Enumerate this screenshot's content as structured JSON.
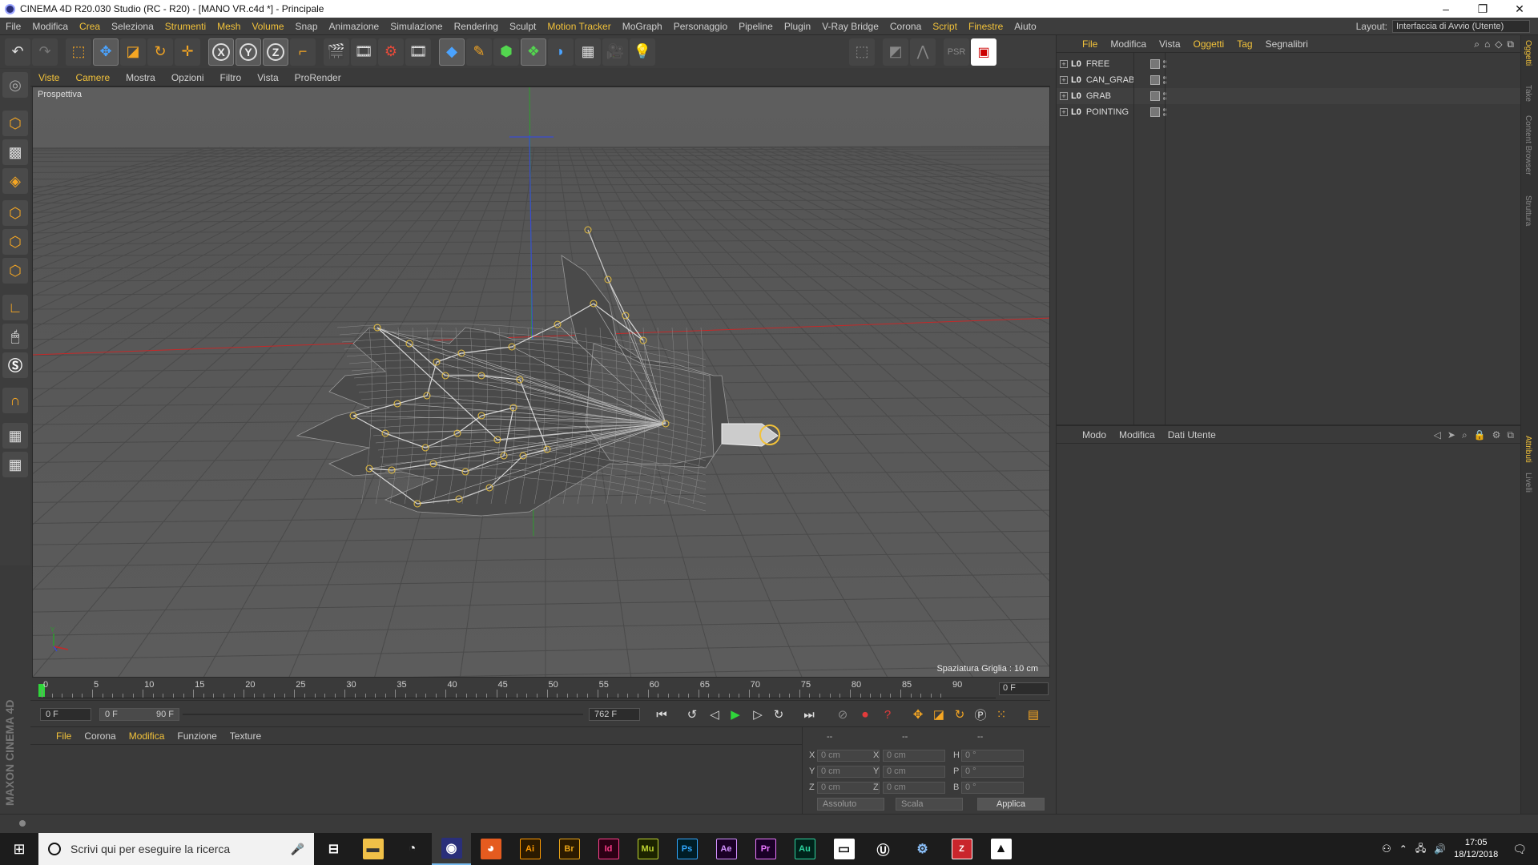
{
  "window": {
    "title": "CINEMA 4D R20.030 Studio (RC - R20) - [MANO VR.c4d *] - Principale",
    "controls": [
      "–",
      "❐",
      "✕"
    ]
  },
  "menubar": {
    "items": [
      "File",
      "Modifica",
      "Crea",
      "Seleziona",
      "Strumenti",
      "Mesh",
      "Volume",
      "Snap",
      "Animazione",
      "Simulazione",
      "Rendering",
      "Sculpt",
      "Motion Tracker",
      "MoGraph",
      "Personaggio",
      "Pipeline",
      "Plugin",
      "V-Ray Bridge",
      "Corona",
      "Script",
      "Finestre",
      "Aiuto"
    ],
    "highlighted": [
      "Crea",
      "Strumenti",
      "Mesh",
      "Volume",
      "Motion Tracker",
      "Script",
      "Finestre"
    ],
    "layout_label": "Layout:",
    "layout_value": "Interfaccia di Avvio (Utente)"
  },
  "toolbar": {
    "axis_x": "X",
    "axis_y": "Y",
    "axis_z": "Z"
  },
  "viewport": {
    "menu": [
      "Viste",
      "Camere",
      "Mostra",
      "Opzioni",
      "Filtro",
      "Vista",
      "ProRender"
    ],
    "menu_highlighted": [
      "Viste",
      "Camere"
    ],
    "label": "Prospettiva",
    "grid_spacing": "Spaziatura Griglia : 10 cm",
    "axis_y_label": "Y"
  },
  "timeline": {
    "ticks": [
      "0",
      "5",
      "10",
      "15",
      "20",
      "25",
      "30",
      "35",
      "40",
      "45",
      "50",
      "55",
      "60",
      "65",
      "70",
      "75",
      "80",
      "85",
      "90"
    ],
    "current_frame": "0 F",
    "start_field": "0 F",
    "range_start": "0 F",
    "range_end": "90 F",
    "end_field": "762 F"
  },
  "material_panel": {
    "menu": [
      "File",
      "Corona",
      "Modifica",
      "Funzione",
      "Texture"
    ],
    "menu_highlighted": [
      "File",
      "Modifica"
    ]
  },
  "coord_panel": {
    "headers": [
      "--",
      "--",
      "--"
    ],
    "rows": [
      {
        "a": "X",
        "av": "0 cm",
        "b": "X",
        "bv": "0 cm",
        "c": "H",
        "cv": "0 °"
      },
      {
        "a": "Y",
        "av": "0 cm",
        "b": "Y",
        "bv": "0 cm",
        "c": "P",
        "cv": "0 °"
      },
      {
        "a": "Z",
        "av": "0 cm",
        "b": "Z",
        "bv": "0 cm",
        "c": "B",
        "cv": "0 °"
      }
    ],
    "mode1": "Assoluto",
    "mode2": "Scala",
    "apply": "Applica"
  },
  "objects_panel": {
    "menu": [
      "File",
      "Modifica",
      "Vista",
      "Oggetti",
      "Tag",
      "Segnalibri"
    ],
    "menu_highlighted": [
      "File",
      "Oggetti",
      "Tag"
    ],
    "objects": [
      "FREE",
      "CAN_GRAB",
      "GRAB",
      "POINTING"
    ]
  },
  "attributes_panel": {
    "menu": [
      "Modo",
      "Modifica",
      "Dati Utente"
    ]
  },
  "side_tabs": [
    "Oggetti",
    "Take",
    "Content Browser",
    "Struttura",
    "Attributi",
    "Livelli"
  ],
  "maxon_logo": "MAXON CINEMA 4D",
  "taskbar": {
    "search_placeholder": "Scrivi qui per eseguire la ricerca",
    "apps": [
      {
        "label": "",
        "bg": "#1c1c1c",
        "fg": "#fff"
      },
      {
        "label": "",
        "bg": "#f0c048",
        "fg": "#333"
      },
      {
        "label": "",
        "bg": "#1c1c1c",
        "fg": "#fff"
      },
      {
        "label": "",
        "bg": "#2a2f7a",
        "fg": "#fff"
      },
      {
        "label": "",
        "bg": "#e55b1f",
        "fg": "#fff"
      },
      {
        "label": "Ai",
        "bg": "#2b1a00",
        "fg": "#ff9a00"
      },
      {
        "label": "Br",
        "bg": "#2b1a00",
        "fg": "#e8a317"
      },
      {
        "label": "Id",
        "bg": "#2b0014",
        "fg": "#ff3d8b"
      },
      {
        "label": "Mu",
        "bg": "#1c2300",
        "fg": "#bfd530"
      },
      {
        "label": "Ps",
        "bg": "#001d26",
        "fg": "#31a8ff"
      },
      {
        "label": "Ae",
        "bg": "#1a0026",
        "fg": "#d291ff"
      },
      {
        "label": "Pr",
        "bg": "#1a0026",
        "fg": "#ea77ff"
      },
      {
        "label": "Au",
        "bg": "#00221a",
        "fg": "#2dd6a0"
      },
      {
        "label": "",
        "bg": "#fff",
        "fg": "#111"
      },
      {
        "label": "",
        "bg": "#1c1c1c",
        "fg": "#fff"
      },
      {
        "label": "",
        "bg": "#1c1c1c",
        "fg": "#8ec4ff"
      },
      {
        "label": "Z",
        "bg": "#c9252c",
        "fg": "#fff"
      },
      {
        "label": "",
        "bg": "#fff",
        "fg": "#111"
      }
    ],
    "time": "17:05",
    "date": "18/12/2018"
  }
}
